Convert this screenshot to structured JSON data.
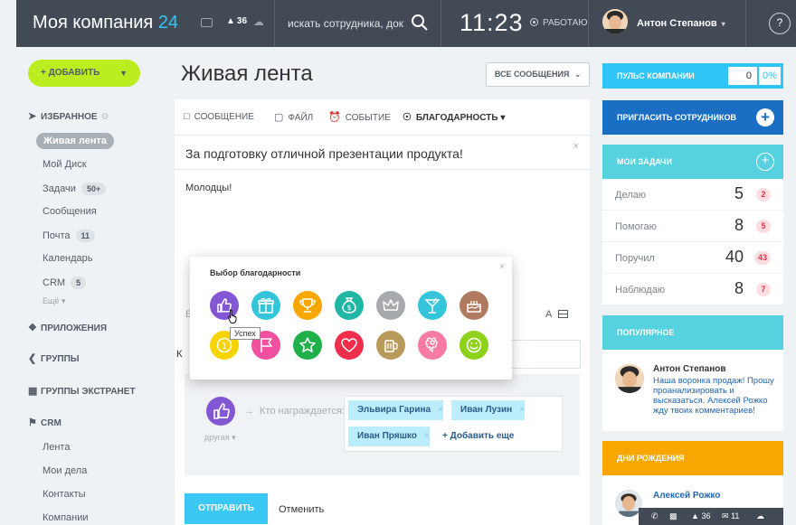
{
  "topbar": {
    "company": "Моя компания",
    "company_num": "24",
    "notif_count": "36",
    "search_placeholder": "искать сотрудника, док",
    "time": "11:23",
    "status": "РАБОТАЮ",
    "user": "Антон Степанов",
    "help": "?"
  },
  "sidebar": {
    "add_label": "+ ДОБАВИТЬ",
    "favorites": "ИЗБРАННОЕ",
    "items": [
      {
        "label": "Живая лента",
        "count": ""
      },
      {
        "label": "Мой Диск",
        "count": ""
      },
      {
        "label": "Задачи",
        "count": "50+"
      },
      {
        "label": "Сообщения",
        "count": ""
      },
      {
        "label": "Почта",
        "count": "11"
      },
      {
        "label": "Календарь",
        "count": ""
      },
      {
        "label": "CRM",
        "count": "5"
      }
    ],
    "more": "Ещё",
    "apps": "ПРИЛОЖЕНИЯ",
    "groups": "ГРУППЫ",
    "extranet": "ГРУППЫ ЭКСТРАНЕТ",
    "crm": "CRM",
    "crm_items": [
      "Лента",
      "Мои дела",
      "Контакты",
      "Компании"
    ]
  },
  "main": {
    "title": "Живая лента",
    "filter": "ВСЕ СООБЩЕНИЯ",
    "tabs": [
      "СООБЩЕНИЕ",
      "ФАЙЛ",
      "СОБЫТИЕ",
      "БЛАГОДАРНОСТЬ"
    ],
    "theme": "За подготовку отличной презентации продукта!",
    "body": "Молодцы!",
    "toolbar_a": "A",
    "cut_b": "Б",
    "cut_k": "К",
    "grat_arrow": "→",
    "recipients_label": "Кто награждается:",
    "grat_sub": "другая",
    "users": [
      "Эльвира Гарина",
      "Иван Лузин",
      "Иван Пряшко"
    ],
    "add_more": "+ Добавить еще",
    "send": "ОТПРАВИТЬ",
    "cancel": "Отменить"
  },
  "popup": {
    "title": "Выбор благодарности",
    "tooltip": "Успех",
    "icons": [
      {
        "name": "thumb-up-icon",
        "color": "#8356d4"
      },
      {
        "name": "gift-icon",
        "color": "#35c5da"
      },
      {
        "name": "cup-icon",
        "color": "#f7a700"
      },
      {
        "name": "money-icon",
        "color": "#1fb6a4"
      },
      {
        "name": "crown-icon",
        "color": "#a6a9ad"
      },
      {
        "name": "cocktail-icon",
        "color": "#35c5da"
      },
      {
        "name": "cake-icon",
        "color": "#b07a5e"
      },
      {
        "name": "medal-icon",
        "color": "#f7d400"
      },
      {
        "name": "flag-icon",
        "color": "#f14fa0"
      },
      {
        "name": "star-icon",
        "color": "#1fb04a"
      },
      {
        "name": "heart-icon",
        "color": "#f02e4c"
      },
      {
        "name": "beer-icon",
        "color": "#b89b5a"
      },
      {
        "name": "flower-icon",
        "color": "#f77ba3"
      },
      {
        "name": "smile-icon",
        "color": "#8fd21b"
      }
    ]
  },
  "right": {
    "pulse": "ПУЛЬС КОМПАНИИ",
    "pulse_val": "0",
    "pulse_pct": "0%",
    "invite": "ПРИГЛАСИТЬ СОТРУДНИКОВ",
    "tasks_title": "МОИ ЗАДАЧИ",
    "tasks": [
      {
        "label": "Делаю",
        "num": "5",
        "badge": "2"
      },
      {
        "label": "Помогаю",
        "num": "8",
        "badge": "5"
      },
      {
        "label": "Поручил",
        "num": "40",
        "badge": "43"
      },
      {
        "label": "Наблюдаю",
        "num": "8",
        "badge": "7"
      }
    ],
    "popular_title": "ПОПУЛЯРНОЕ",
    "popular_name": "Антон Степанов",
    "popular_text": "Наша воронка продаж! Прошу проанализировать и высказаться. Алексей Рожко жду твоих комментариев!",
    "bd_title": "ДНИ РОЖДЕНИЯ",
    "bd_name": "Алексей Рожко"
  },
  "bottom": {
    "notif": "36",
    "mail": "11"
  },
  "colors": {
    "topbar": "#424a56",
    "accent": "#2fc6f6",
    "add": "#bbed21",
    "invite": "#1a6ec4",
    "birthday": "#f7a700"
  }
}
